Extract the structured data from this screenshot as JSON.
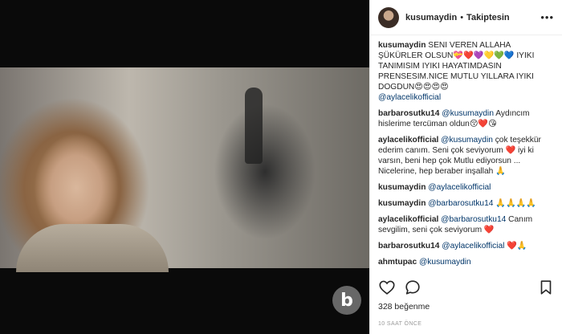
{
  "header": {
    "username": "kusumaydin",
    "separator": "•",
    "follow_label": "Takiptesin",
    "more_label": "•••"
  },
  "comments": [
    {
      "user": "kusumaydin",
      "text": "SENI VEREN ALLAHA ŞÜKÜRLER OLSUN💝❤️💜💛💚💙 IYIKI TANIMISIM IYIKI HAYATIMDASIN PRENSESIM.NICE MUTLU YILLARA IYIKI DOGDUN😍😍😍😍",
      "mention": "@aylacelikofficial",
      "mention_first": false
    },
    {
      "user": "barbarosutku14",
      "text": " Aydıncım hislerime tercüman oldun😚❤️😘",
      "mention": "@kusumaydin",
      "mention_first": true
    },
    {
      "user": "aylacelikofficial",
      "text": " çok teşekkür ederim canım. Seni çok seviyorum ❤️ iyi ki varsın, beni hep çok Mutlu ediyorsun ... Nicelerine, hep beraber inşallah 🙏",
      "mention": "@kusumaydin",
      "mention_first": true
    },
    {
      "user": "kusumaydin",
      "text": "",
      "mention": "@aylacelikofficial",
      "mention_first": true
    },
    {
      "user": "kusumaydin",
      "text": " 🙏🙏🙏🙏",
      "mention": "@barbarosutku14",
      "mention_first": true
    },
    {
      "user": "aylacelikofficial",
      "text": " Canım sevgilim, seni çok seviyorum ❤️",
      "mention": "@barbarosutku14",
      "mention_first": true
    },
    {
      "user": "barbarosutku14",
      "text": " ❤️🙏",
      "mention": "@aylacelikofficial",
      "mention_first": true
    },
    {
      "user": "ahmtupac",
      "text": "",
      "mention": "@kusumaydin",
      "mention_first": true
    }
  ],
  "actions": {
    "like_icon": "heart-icon",
    "comment_icon": "comment-icon",
    "bookmark_icon": "bookmark-icon"
  },
  "likes_label": "328 beğenme",
  "time_label": "10 SAAT ÖNCE",
  "watermark": "b"
}
